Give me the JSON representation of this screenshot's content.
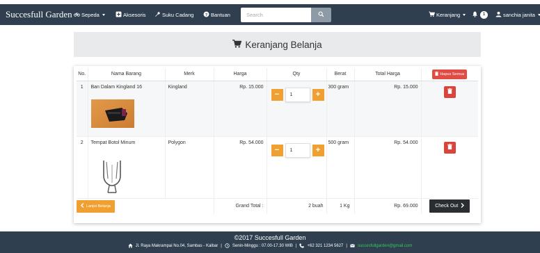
{
  "navbar": {
    "brand": "Succesfull Garden",
    "items": [
      {
        "label": "Sepeda",
        "icon": "bicycle-icon",
        "dropdown": true
      },
      {
        "label": "Aksesoris",
        "icon": "plus-square-icon",
        "dropdown": false
      },
      {
        "label": "Suku Cadang",
        "icon": "wrench-icon",
        "dropdown": false
      },
      {
        "label": "Bantuan",
        "icon": "question-circle-icon",
        "dropdown": false
      }
    ],
    "search_placeholder": "Search",
    "cart_label": "Keranjang",
    "notification_count": "1",
    "user_label": "sanchia janita"
  },
  "header": {
    "title": "Keranjang Belanja",
    "icon": "shopping-cart-icon"
  },
  "cart": {
    "columns": {
      "no": "No.",
      "name": "Nama Barang",
      "merk": "Merk",
      "harga": "Harga",
      "qty": "Qty",
      "berat": "Berat",
      "total": "Total Harga",
      "hapus_semua": "Hapus Semua"
    },
    "items": [
      {
        "no": "1",
        "name": "Ban Dalam Kingland 16",
        "merk": "Kingland",
        "harga": "Rp. 15.000",
        "qty": "1",
        "berat": "300 gram",
        "total": "Rp. 15.000"
      },
      {
        "no": "2",
        "name": "Tempat Botol Minum",
        "merk": "Polygon",
        "harga": "Rp. 54.000",
        "qty": "1",
        "berat": "500 gram",
        "total": "Rp. 54.000"
      }
    ],
    "grand_total_label": "Grand Total :",
    "total_qty": "2 buah",
    "total_weight": "1 Kg",
    "grand_total": "Rp. 69.000",
    "continue_label": "Lanjut Belanja",
    "checkout_label": "Check Out",
    "minus": "−",
    "plus": "+"
  },
  "footer": {
    "copyright": "©2017 Succesfull Garden",
    "address": "Jl. Raya Makrampai No.04, Sambas - Kalbar",
    "hours": "Senin-Minggu : 07.00-17.30 WIB",
    "phone": "+62 321 1234 5627",
    "email": "succesfullgarden@gmail.com",
    "separator": "|"
  },
  "colors": {
    "navbar": "#2f3f4f",
    "orange": "#f0a030",
    "red": "#d9443b",
    "dark_button": "#2a2d31",
    "email_green": "#33cc55"
  }
}
